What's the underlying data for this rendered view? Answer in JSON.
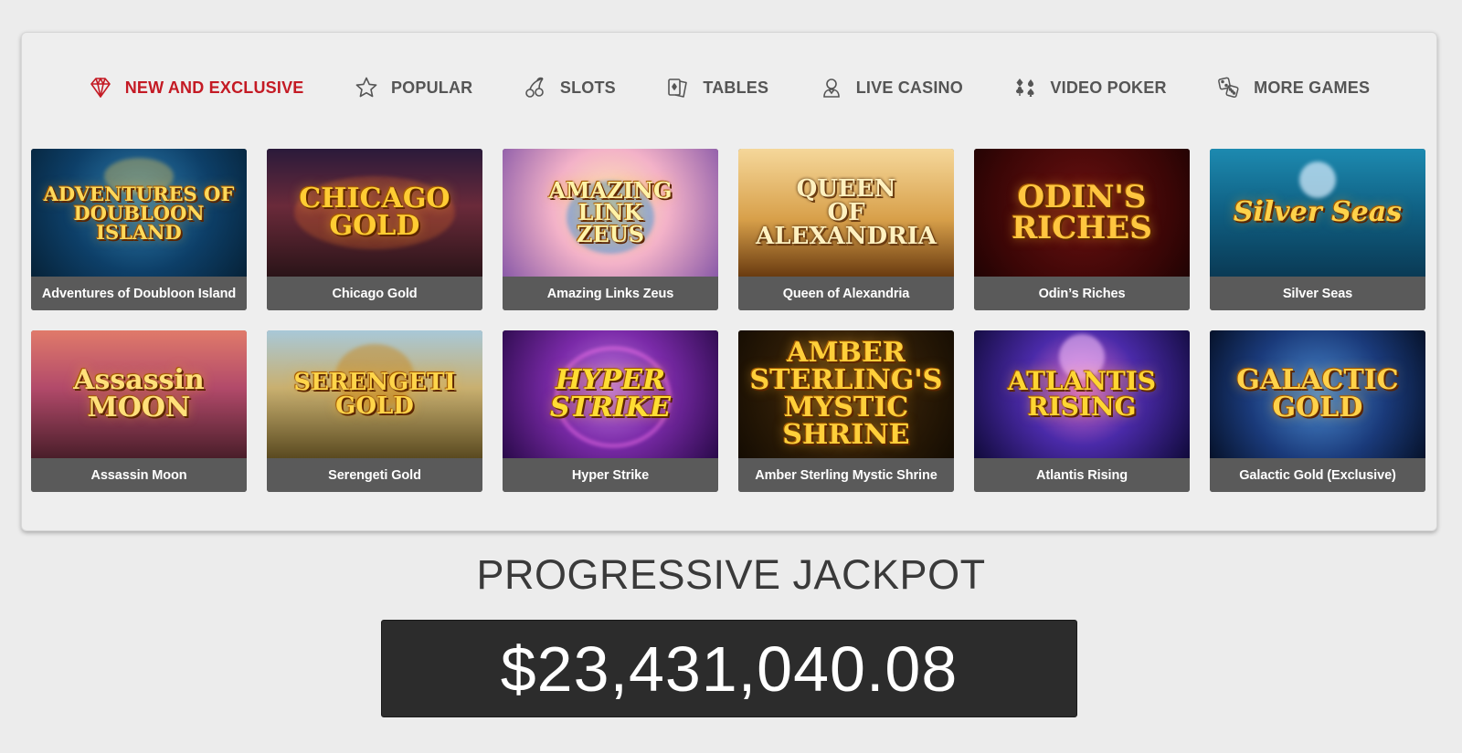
{
  "nav": {
    "items": [
      {
        "label": "NEW AND EXCLUSIVE",
        "icon": "diamond-icon",
        "active": true
      },
      {
        "label": "POPULAR",
        "icon": "star-icon"
      },
      {
        "label": "SLOTS",
        "icon": "cherries-icon"
      },
      {
        "label": "TABLES",
        "icon": "cards-icon"
      },
      {
        "label": "LIVE CASINO",
        "icon": "dealer-icon"
      },
      {
        "label": "VIDEO POKER",
        "icon": "suits-icon"
      },
      {
        "label": "MORE GAMES",
        "icon": "dice-icon"
      }
    ],
    "active_color": "#c41a24",
    "inactive_color": "#555555"
  },
  "games": [
    {
      "title": "Adventures of Doubloon Island",
      "art": "ADVENTURES OF\nDOUBLOON\nISLAND"
    },
    {
      "title": "Chicago Gold",
      "art": "CHICAGO\nGOLD"
    },
    {
      "title": "Amazing Links Zeus",
      "art": "AMAZING\nLINK\nZEUS"
    },
    {
      "title": "Queen of Alexandria",
      "art": "QUEEN\nOF\nALEXANDRIA"
    },
    {
      "title": "Odin’s Riches",
      "art": "ODIN'S\nRICHES"
    },
    {
      "title": "Silver Seas",
      "art": "Silver Seas"
    },
    {
      "title": "Assassin Moon",
      "art": "Assassin\nMOON"
    },
    {
      "title": "Serengeti Gold",
      "art": "SERENGETI\nGOLD"
    },
    {
      "title": "Hyper Strike",
      "art": "HYPER\nSTRIKE"
    },
    {
      "title": "Amber Sterling Mystic Shrine",
      "art": "AMBER STERLING'S\nMYSTIC\nSHRINE"
    },
    {
      "title": "Atlantis Rising",
      "art": "ATLANTIS\nRISING"
    },
    {
      "title": "Galactic Gold (Exclusive)",
      "art": "GALACTIC\nGOLD"
    }
  ],
  "jackpot": {
    "title": "PROGRESSIVE JACKPOT",
    "value": "$23,431,040.08"
  }
}
